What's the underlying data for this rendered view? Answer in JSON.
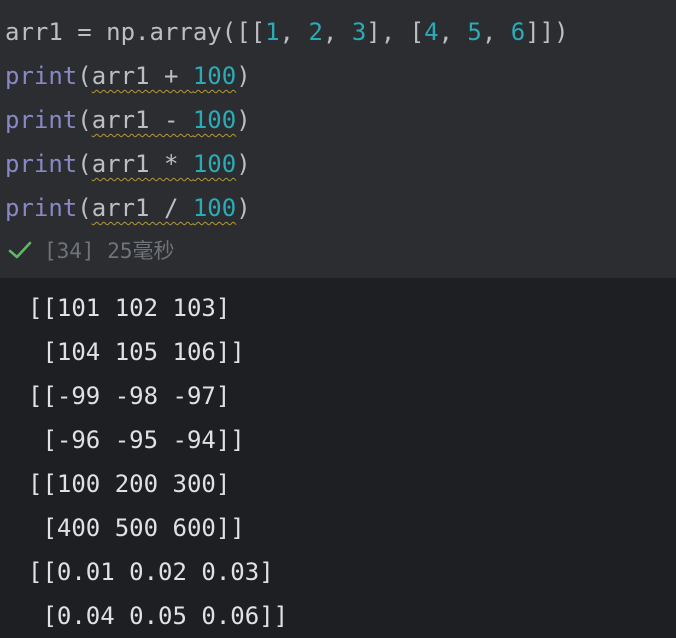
{
  "code": {
    "line1": {
      "prefix": "arr1 = np.array([[",
      "n1": "1",
      "sep1": ", ",
      "n2": "2",
      "sep2": ", ",
      "n3": "3",
      "mid": "], [",
      "n4": "4",
      "sep3": ", ",
      "n5": "5",
      "sep4": ", ",
      "n6": "6",
      "suffix": "]])"
    },
    "print_lines": [
      {
        "fn": "print",
        "open": "(",
        "expr": "arr1 + ",
        "num": "100",
        "close": ")"
      },
      {
        "fn": "print",
        "open": "(",
        "expr": "arr1 - ",
        "num": "100",
        "close": ")"
      },
      {
        "fn": "print",
        "open": "(",
        "expr": "arr1 * ",
        "num": "100",
        "close": ")"
      },
      {
        "fn": "print",
        "open": "(",
        "expr": "arr1 / ",
        "num": "100",
        "close": ")"
      }
    ]
  },
  "status": {
    "icon": "check-icon",
    "text": "[34] 25毫秒",
    "icon_color": "#5fb865"
  },
  "output": [
    "[[101 102 103]",
    " [104 105 106]]",
    "[[-99 -98 -97]",
    " [-96 -95 -94]]",
    "[[100 200 300]",
    " [400 500 600]]",
    "[[0.01 0.02 0.03]",
    " [0.04 0.05 0.06]]"
  ],
  "colors": {
    "editor_bg": "#2b2d30",
    "output_bg": "#1e1f22",
    "keyword": "#8888c6",
    "number": "#2aacb8",
    "text": "#bcbec4"
  }
}
